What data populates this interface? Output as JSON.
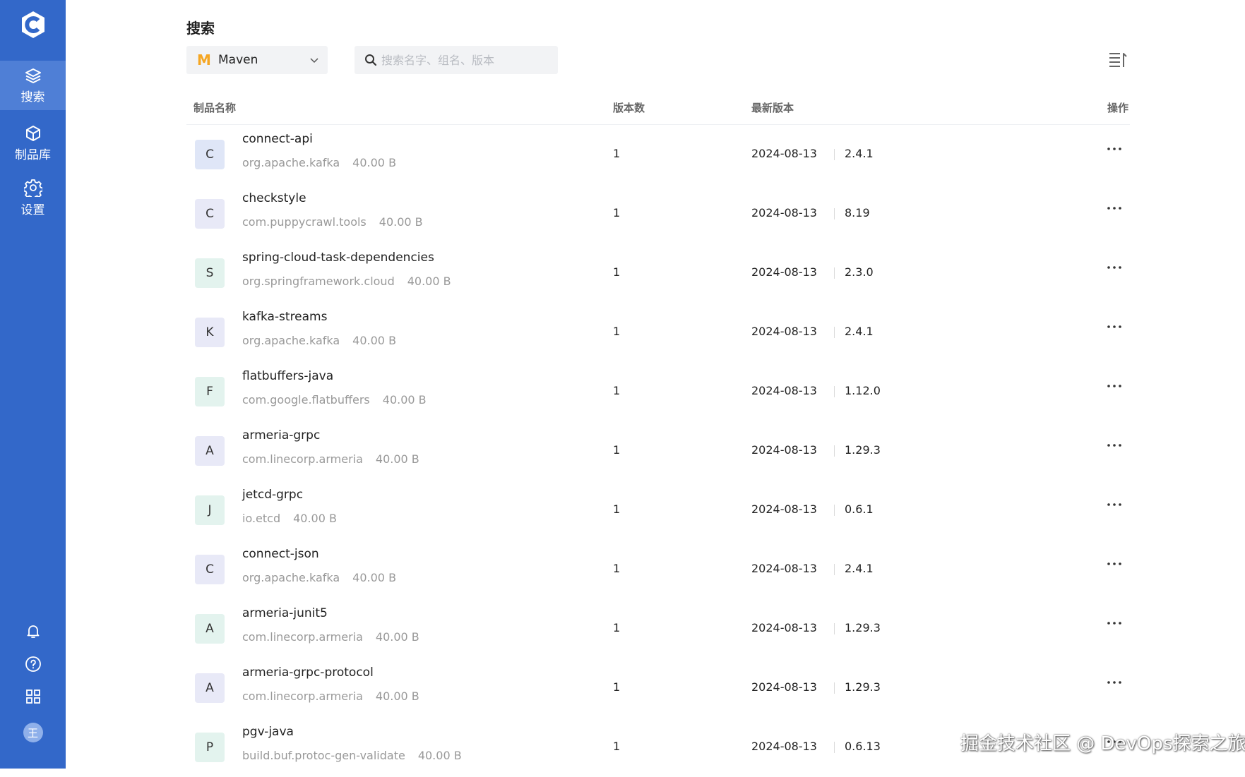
{
  "sidebar": {
    "nav": [
      {
        "label": "搜索",
        "icon": "layers-icon",
        "active": true
      },
      {
        "label": "制品库",
        "icon": "package-icon",
        "active": false
      },
      {
        "label": "设置",
        "icon": "gear-icon",
        "active": false
      }
    ],
    "bottom_icons": [
      "bell-icon",
      "help-icon",
      "apps-grid-icon"
    ],
    "avatar_text": "王"
  },
  "page_title": "搜索",
  "repo_select": {
    "logo": "M",
    "value": "Maven"
  },
  "search": {
    "placeholder": "搜索名字、组名、版本"
  },
  "table": {
    "headers": {
      "name": "制品名称",
      "count": "版本数",
      "latest": "最新版本",
      "action": "操作"
    },
    "rows": [
      {
        "letter": "C",
        "name": "connect-api",
        "group": "org.apache.kafka",
        "size": "40.00 B",
        "count": "1",
        "date": "2024-08-13",
        "version": "2.4.1",
        "color": "#dfe6f7"
      },
      {
        "letter": "C",
        "name": "checkstyle",
        "group": "com.puppycrawl.tools",
        "size": "40.00 B",
        "count": "1",
        "date": "2024-08-13",
        "version": "8.19",
        "color": "#e8e9f7"
      },
      {
        "letter": "S",
        "name": "spring-cloud-task-dependencies",
        "group": "org.springframework.cloud",
        "size": "40.00 B",
        "count": "1",
        "date": "2024-08-13",
        "version": "2.3.0",
        "color": "#e3f3ee"
      },
      {
        "letter": "K",
        "name": "kafka-streams",
        "group": "org.apache.kafka",
        "size": "40.00 B",
        "count": "1",
        "date": "2024-08-13",
        "version": "2.4.1",
        "color": "#e8e9f7"
      },
      {
        "letter": "F",
        "name": "flatbuffers-java",
        "group": "com.google.flatbuffers",
        "size": "40.00 B",
        "count": "1",
        "date": "2024-08-13",
        "version": "1.12.0",
        "color": "#e3f3ee"
      },
      {
        "letter": "A",
        "name": "armeria-grpc",
        "group": "com.linecorp.armeria",
        "size": "40.00 B",
        "count": "1",
        "date": "2024-08-13",
        "version": "1.29.3",
        "color": "#e8e9f7"
      },
      {
        "letter": "J",
        "name": "jetcd-grpc",
        "group": "io.etcd",
        "size": "40.00 B",
        "count": "1",
        "date": "2024-08-13",
        "version": "0.6.1",
        "color": "#e3f3ee"
      },
      {
        "letter": "C",
        "name": "connect-json",
        "group": "org.apache.kafka",
        "size": "40.00 B",
        "count": "1",
        "date": "2024-08-13",
        "version": "2.4.1",
        "color": "#e8e9f7"
      },
      {
        "letter": "A",
        "name": "armeria-junit5",
        "group": "com.linecorp.armeria",
        "size": "40.00 B",
        "count": "1",
        "date": "2024-08-13",
        "version": "1.29.3",
        "color": "#e3f3ee"
      },
      {
        "letter": "A",
        "name": "armeria-grpc-protocol",
        "group": "com.linecorp.armeria",
        "size": "40.00 B",
        "count": "1",
        "date": "2024-08-13",
        "version": "1.29.3",
        "color": "#e8e9f7"
      },
      {
        "letter": "P",
        "name": "pgv-java",
        "group": "build.buf.protoc-gen-validate",
        "size": "40.00 B",
        "count": "1",
        "date": "2024-08-13",
        "version": "0.6.13",
        "color": "#e3f3ee"
      }
    ]
  },
  "watermark": "掘金技术社区 @ DevOps探索之旅"
}
